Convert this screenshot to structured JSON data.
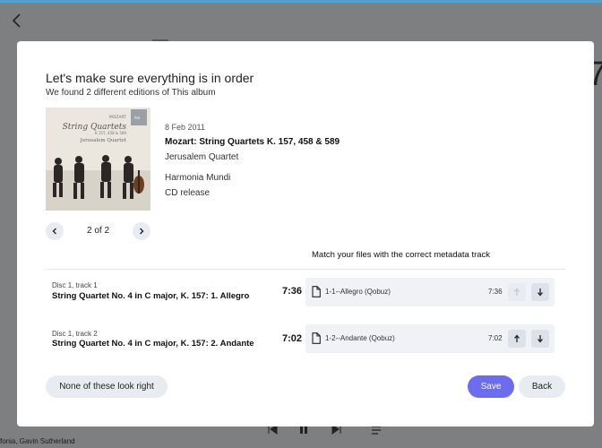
{
  "background": {
    "footer_text": "fonia, Gavin Sutherland",
    "partial_text": "7"
  },
  "dialog": {
    "title": "Let's make sure everything is in order",
    "subtitle": "We found 2 different editions of This album",
    "edition": {
      "cover_icon": "album-cover",
      "cover_text": {
        "composer": "MOZART",
        "title": "String Quartets",
        "catalog": "K.157, 458 & 589",
        "performer": "Jerusalem Quartet"
      },
      "date": "8 Feb 2011",
      "album": "Mozart: String Quartets K. 157, 458 & 589",
      "artist": "Jerusalem Quartet",
      "label": "Harmonia Mundi",
      "release_type": "CD release"
    },
    "pagination": {
      "text": "2 of 2"
    },
    "match_header": "Match your files with the correct metadata track",
    "tracks": [
      {
        "disc": "Disc 1, track 1",
        "title": "String Quartet No. 4 in C major, K. 157: 1. Allegro",
        "duration": "7:36",
        "file": "1-1--Allegro (Qobuz)",
        "file_duration": "7:36"
      },
      {
        "disc": "Disc 1, track 2",
        "title": "String Quartet No. 4 in C major, K. 157: 2. Andante",
        "duration": "7:02",
        "file": "1-2--Andante (Qobuz)",
        "file_duration": "7:02"
      }
    ],
    "buttons": {
      "none": "None of these look right",
      "save": "Save",
      "back": "Back"
    }
  },
  "colors": {
    "accent": "#6c6cf0",
    "overlay": "#7e7f81",
    "top_bar": "#4ea3cf",
    "button_bg": "#e8ecf2"
  }
}
